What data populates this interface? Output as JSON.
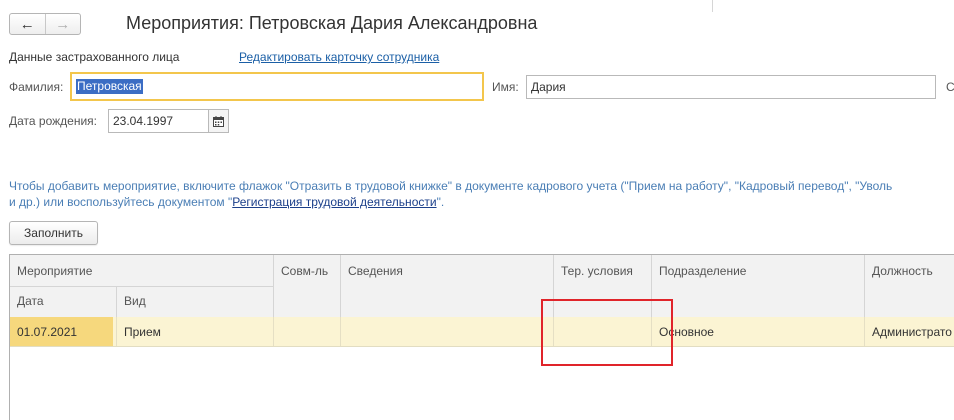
{
  "nav": {
    "back_icon": "←",
    "forward_icon": "→"
  },
  "title": "Мероприятия: Петровская Дария Александровна",
  "insured": {
    "section_label": "Данные застрахованного лица",
    "edit_link": "Редактировать карточку сотрудника",
    "surname_label": "Фамилия:",
    "surname_value": "Петровская",
    "name_label": "Имя:",
    "name_value": "Дария",
    "cut_label": "С",
    "dob_label": "Дата рождения:",
    "dob_value": "23.04.1997"
  },
  "info": {
    "line1": "Чтобы добавить мероприятие, включите флажок \"Отразить в трудовой книжке\" в документе кадрового учета (\"Прием на работу\", \"Кадровый перевод\", \"Уволь",
    "line2_prefix": "и др.) или воспользуйтесь документом \"",
    "line2_link": "Регистрация трудовой деятельности",
    "line2_suffix": "\"."
  },
  "fill_button": "Заполнить",
  "table": {
    "headers": {
      "event": "Мероприятие",
      "date": "Дата",
      "kind": "Вид",
      "combo": "Совм-ль",
      "info": "Сведения",
      "ter": "Тер. условия",
      "dept": "Подразделение",
      "position": "Должность"
    },
    "rows": [
      {
        "date": "01.07.2021",
        "kind": "Прием",
        "combo": "",
        "info": "",
        "ter": "",
        "dept": "Основное",
        "position": "Администрато"
      }
    ]
  },
  "colors": {
    "accent_link": "#1b5fa6",
    "info_text": "#4a7eb5",
    "focus_border": "#f3c64c",
    "selected_row": "#fbf4d3",
    "selected_cell": "#f6d87d",
    "highlight_box": "#e0242a"
  }
}
